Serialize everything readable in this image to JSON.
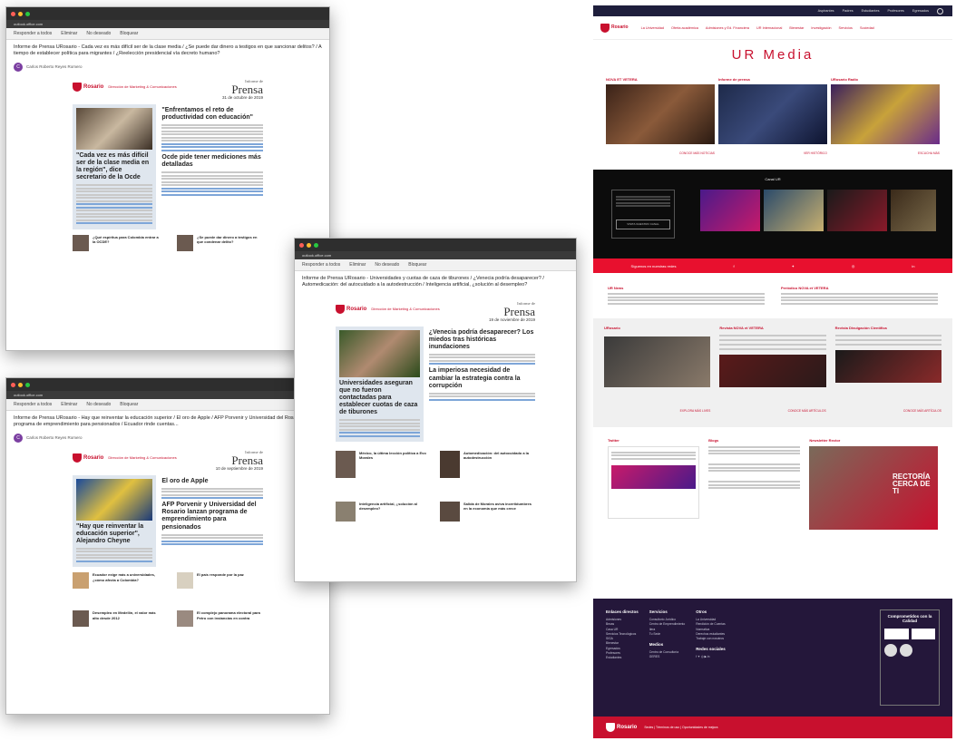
{
  "email_common": {
    "reply": "Responder a todos",
    "delete": "Eliminar",
    "junk": "No deseado",
    "block": "Bloquear",
    "address": "outlook.office.com",
    "sender": "Carlos Roberto Reyes Romero",
    "logo_text": "Rosario",
    "office": "Dirección de Marketing & Comunicaciones",
    "informe_de": "Informe de",
    "prensa": "Prensa"
  },
  "email1": {
    "subject": "Informe de Prensa URosario - Cada vez es más difícil ser de la clase media / ¿Se puede dar dinero a testigos en que sancionar delitos? / A tiempo de establecer política para migrantes / ¿Reelección presidencial vía decreto humano?",
    "date": "31 de octubre de 2019",
    "headline1": "\"Cada vez es más difícil ser de la clase media en la región\", dice secretario de la Ocde",
    "headline2": "\"Enfrentamos el reto de productividad con educación\"",
    "headline3": "Ocde pide tener mediciones más detalladas",
    "mini1": "¿Qué espíritus para Colombia entrar a la OCDE?",
    "mini2": "¿Se puede dar dinero a testigos en que condenar delito?"
  },
  "email2": {
    "subject": "Informe de Prensa URosario - Universidades y cuotas de caza de tiburones / ¿Venecia podría desaparecer? / Automedicación: del autocuidado a la autodestrucción / Inteligencia artificial, ¿solución al desempleo?",
    "date": "19 de noviembre de 2019",
    "headline1": "Universidades aseguran que no fueron contactadas para establecer cuotas de caza de tiburones",
    "headline2": "¿Venecia podría desaparecer? Los miedos tras históricas inundaciones",
    "headline3": "La imperiosa necesidad de cambiar la estrategia contra la corrupción",
    "mini1": "México, la última lección política a Evo Morales",
    "mini2": "Automedicación: del autocuidado a la autodestrucción",
    "mini3": "Inteligencia artificial, ¿solución al desempleo?",
    "mini4": "Salida de Morales aviva incertidumbres en la economía que más crece"
  },
  "email3": {
    "subject": "Informe de Prensa URosario - Hay que reinventar la educación superior / El oro de Apple / AFP Porvenir y Universidad del Rosario lanzan programa de emprendimiento para pensionados / Ecuador rinde cuentas...",
    "date": "10 de septiembre de 2019",
    "headline1": "\"Hay que reinventar la educación superior\", Alejandro Cheyne",
    "headline2": "El oro de Apple",
    "headline3": "AFP Porvenir y Universidad del Rosario lanzan programa de emprendimiento para pensionados",
    "mini1": "Ecuador exige más a universidades, ¿cómo afecta a Colombia?",
    "mini2": "El país responde por la paz",
    "mini3": "Desempleo en Medellín, el valor más alto desde 2012",
    "mini4": "El complejo panorama electoral para Petro con instancias en contra"
  },
  "site": {
    "topnav": [
      "Aspirantes",
      "Padres",
      "Estudiantes",
      "Profesores",
      "Egresados"
    ],
    "mainnav": [
      "La Universidad",
      "Oferta académica",
      "Admisiones y Ed. Financiera",
      "UR Internacional",
      "Bienestar",
      "Investigación",
      "Servicios",
      "Sociedad"
    ],
    "title": "UR Media",
    "sections": [
      "NOVA ET VETERA",
      "Informe de prensa",
      "URosario Radio"
    ],
    "more": [
      "CONOCE MÁS NOTICIAS",
      "VER HISTÓRICO",
      "ESCUCHA MÁS"
    ],
    "canal": "Canal UR",
    "canal_btn": "VISITA NUESTRO CANAL",
    "social_label": "Síguenos en nuestras redes",
    "news": [
      "UR News",
      "Periódico NOVA et VETERA"
    ],
    "grey": [
      "URosario",
      "Revista NOVA et VETERA",
      "Revista Divulgación Científica"
    ],
    "grey_more": [
      "EXPLORA MÁS LIVES",
      "CONOCE MÁS ARTÍCULOS",
      "CONOCE MÁS ARTÍCULOS"
    ],
    "low": [
      "Twitter",
      "Blogs",
      "Newsletter Rector"
    ],
    "rector_text": "RECTORÍA CERCA DE TI",
    "footer": {
      "col1_title": "Enlaces directos",
      "col1": [
        "Admisiones",
        "Becas",
        "Casa UR",
        "Servicios Tecnológicos",
        "SIGA",
        "Bienestar",
        "Egresados",
        "Profesores",
        "Estudiantes",
        "CRAI",
        "Sedes"
      ],
      "col2_title": "Servicios",
      "col2": [
        "Consultorio Jurídico",
        "Centro de Emprendimiento",
        "Ilera",
        "Tu Sede",
        "Centro de Consultoría",
        "GERES"
      ],
      "col2b_title": "Medios",
      "col3_title": "Otros",
      "col3": [
        "La Universidad",
        "Rendición de Cuentas",
        "Normativa",
        "Derechos estudiantes",
        "Trabaje con nosotros",
        "Términos y condiciones"
      ],
      "col3b_title": "Redes sociales",
      "quality": "Comprometidos con la Calidad"
    },
    "bottom": "Sedes | Términos de uso | Oportunidades de mejora"
  },
  "colors": {
    "brand_red": "#c8102e",
    "footer_purple": "#24173a"
  }
}
